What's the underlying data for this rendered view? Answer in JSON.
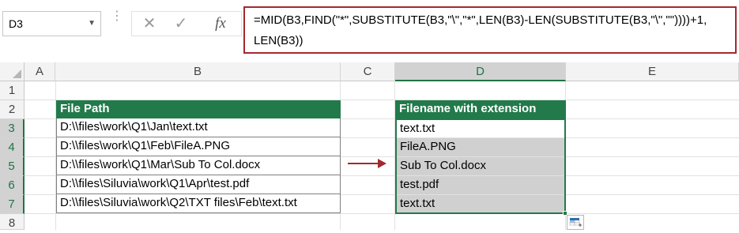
{
  "name_box": {
    "value": "D3"
  },
  "formula_bar": {
    "fx_label": "fx",
    "formula_text": "=MID(B3,FIND(\"*\",SUBSTITUTE(B3,\"\\\",\"*\",LEN(B3)-LEN(SUBSTITUTE(B3,\"\\\",\"\"))))+1,\nLEN(B3))"
  },
  "columns": [
    "A",
    "B",
    "C",
    "D",
    "E"
  ],
  "rows": [
    "1",
    "2",
    "3",
    "4",
    "5",
    "6",
    "7",
    "8"
  ],
  "table_b": {
    "header": "File Path",
    "values": [
      "D:\\\\files\\work\\Q1\\Jan\\text.txt",
      "D:\\\\files\\work\\Q1\\Feb\\FileA.PNG",
      "D:\\\\files\\work\\Q1\\Mar\\Sub To Col.docx",
      "D:\\\\files\\Siluvia\\work\\Q1\\Apr\\test.pdf",
      "D:\\\\files\\Siluvia\\work\\Q2\\TXT files\\Feb\\text.txt"
    ]
  },
  "table_d": {
    "header": "Filename with extension",
    "values": [
      "text.txt",
      "FileA.PNG",
      "Sub To Col.docx",
      "test.pdf",
      "text.txt"
    ]
  },
  "colors": {
    "header_green": "#227a4b",
    "accent_red": "#a5282f",
    "selection_fill": "#d0d0d0"
  }
}
